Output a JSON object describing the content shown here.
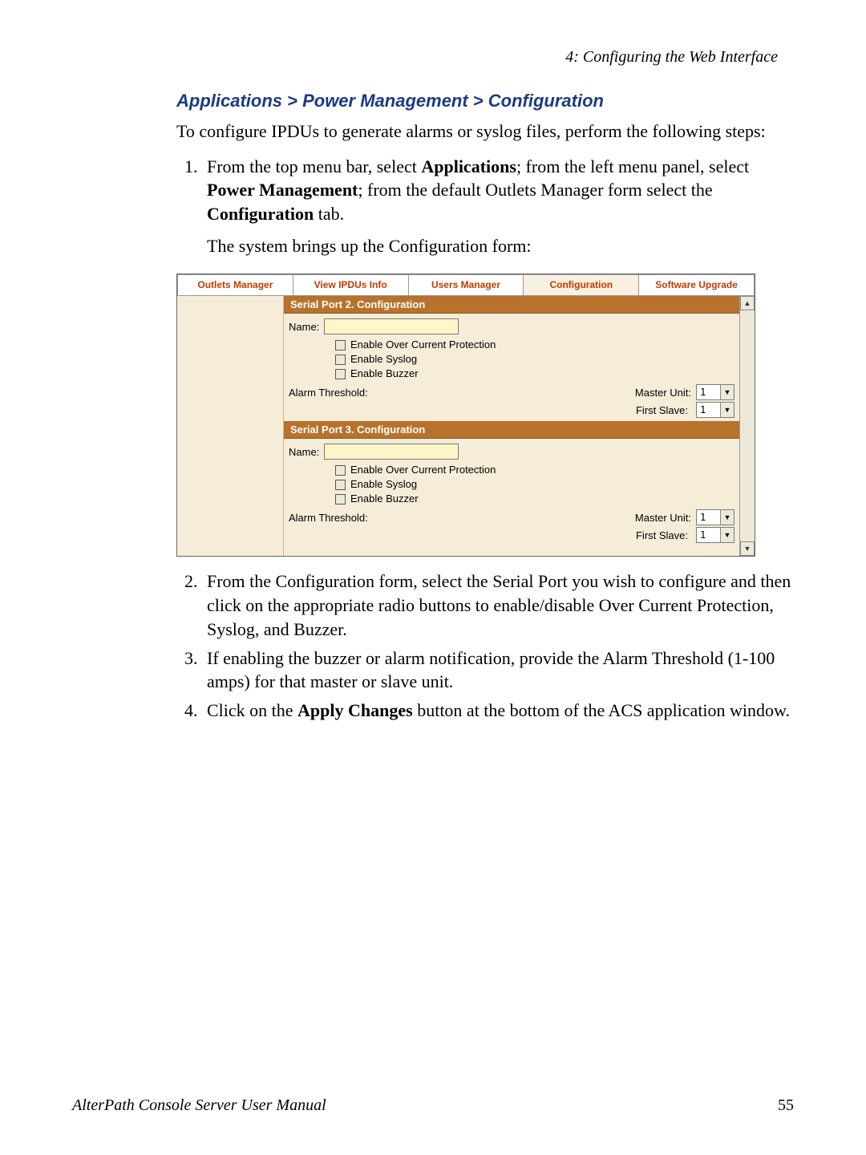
{
  "header": {
    "running": "4: Configuring the Web Interface"
  },
  "section": {
    "title": "Applications > Power Management > Configuration",
    "intro": "To configure IPDUs to generate alarms or syslog files, perform the following steps:"
  },
  "steps": {
    "s1a": "From the top menu bar, select ",
    "s1b": "Applications",
    "s1c": "; from the left menu panel, select ",
    "s1d": "Power Management",
    "s1e": "; from the default Outlets Manager form select the ",
    "s1f": "Configuration",
    "s1g": " tab.",
    "s1sub": "The system brings up the Configuration form:",
    "s2": "From the Configuration form, select the Serial Port you wish to configure and then click on the appropriate radio buttons to enable/disable Over Current Protection, Syslog, and Buzzer.",
    "s3": "If enabling the buzzer or alarm notification, provide the Alarm Threshold (1-100 amps) for that master or slave unit.",
    "s4a": "Click on the ",
    "s4b": "Apply Changes",
    "s4c": " button at the bottom of the ACS application window."
  },
  "ui": {
    "tabs": {
      "outlets": "Outlets Manager",
      "view": "View IPDUs Info",
      "users": "Users Manager",
      "config": "Configuration",
      "upgrade": "Software Upgrade"
    },
    "port2": {
      "header": "Serial Port 2. Configuration",
      "name_label": "Name:",
      "chk_over": "Enable Over Current Protection",
      "chk_syslog": "Enable Syslog",
      "chk_buzzer": "Enable Buzzer",
      "alarm_label": "Alarm Threshold:",
      "master_label": "Master Unit:",
      "master_val": "1",
      "slave_label": "First Slave:",
      "slave_val": "1"
    },
    "port3": {
      "header": "Serial Port 3. Configuration",
      "name_label": "Name:",
      "chk_over": "Enable Over Current Protection",
      "chk_syslog": "Enable Syslog",
      "chk_buzzer": "Enable Buzzer",
      "alarm_label": "Alarm Threshold:",
      "master_label": "Master Unit:",
      "master_val": "1",
      "slave_label": "First Slave:",
      "slave_val": "1"
    }
  },
  "footer": {
    "manual": "AlterPath Console Server User Manual",
    "page": "55"
  }
}
